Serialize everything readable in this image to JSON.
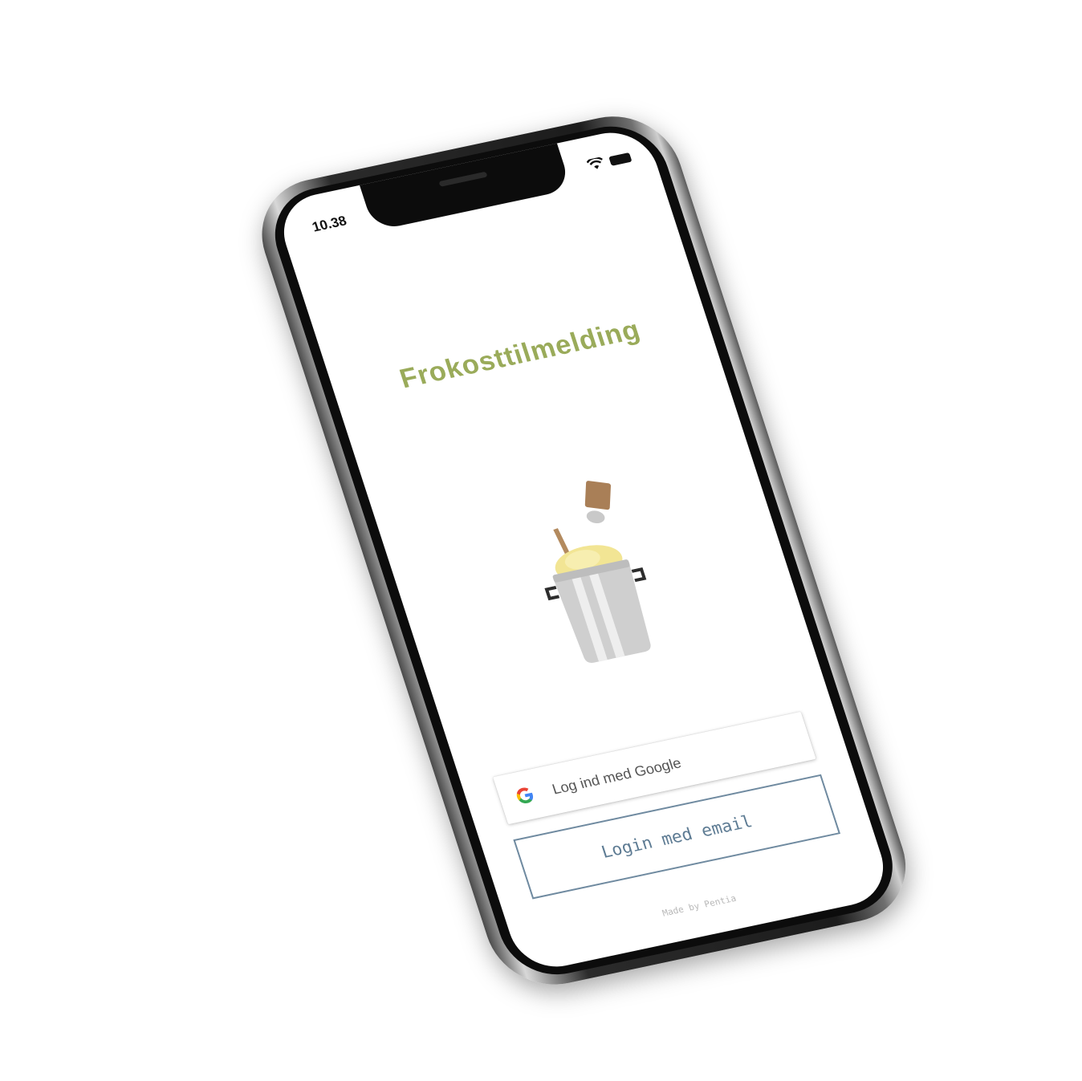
{
  "status_bar": {
    "time": "10.38",
    "icons": [
      "wifi-icon",
      "battery-icon"
    ]
  },
  "app": {
    "title": "Frokosttilmelding",
    "title_color": "#9aab5a",
    "illustration": "cooking-pot-illustration"
  },
  "login": {
    "google_label": "Log ind med Google",
    "email_label": "Login med email",
    "email_border_color": "#6f8aa0"
  },
  "footer": {
    "made_by": "Made by Pentia"
  }
}
